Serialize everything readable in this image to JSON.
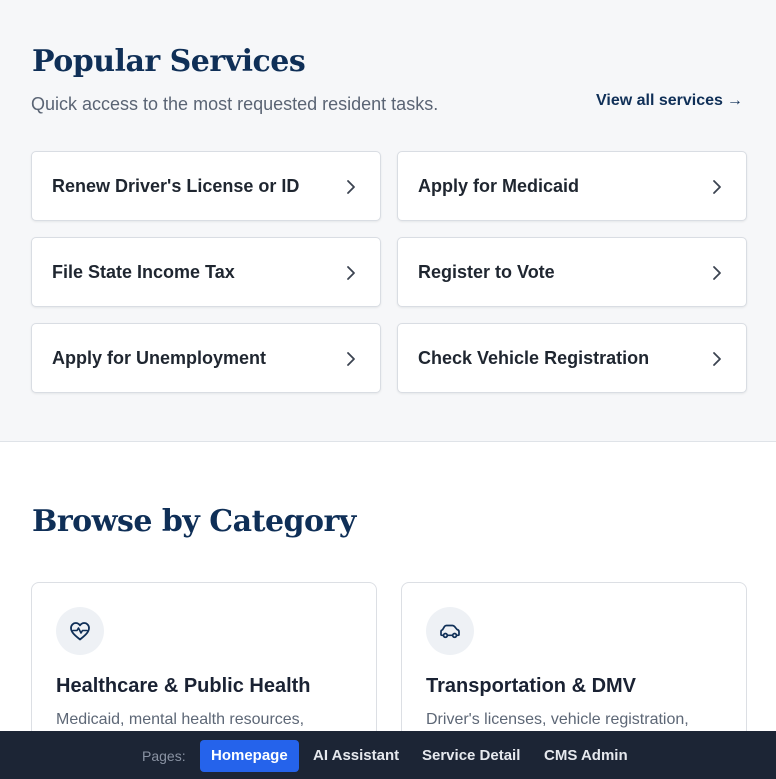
{
  "popular": {
    "title": "Popular Services",
    "subtitle": "Quick access to the most requested resident tasks.",
    "view_all": "View all services",
    "services": [
      {
        "label": "Renew Driver's License or ID"
      },
      {
        "label": "Apply for Medicaid"
      },
      {
        "label": "File State Income Tax"
      },
      {
        "label": "Register to Vote"
      },
      {
        "label": "Apply for Unemployment"
      },
      {
        "label": "Check Vehicle Registration"
      }
    ]
  },
  "browse": {
    "title": "Browse by Category",
    "categories": [
      {
        "icon": "heart-pulse-icon",
        "title": "Healthcare & Public Health",
        "desc": "Medicaid, mental health resources,"
      },
      {
        "icon": "car-icon",
        "title": "Transportation & DMV",
        "desc": "Driver's licenses, vehicle registration,"
      }
    ]
  },
  "pagebar": {
    "label": "Pages:",
    "links": [
      "Homepage",
      "AI Assistant",
      "Service Detail",
      "CMS Admin"
    ],
    "active": "Homepage"
  },
  "colors": {
    "heading": "#0f2f57",
    "accent": "#2563eb",
    "pagebar_bg": "#1c2535"
  }
}
